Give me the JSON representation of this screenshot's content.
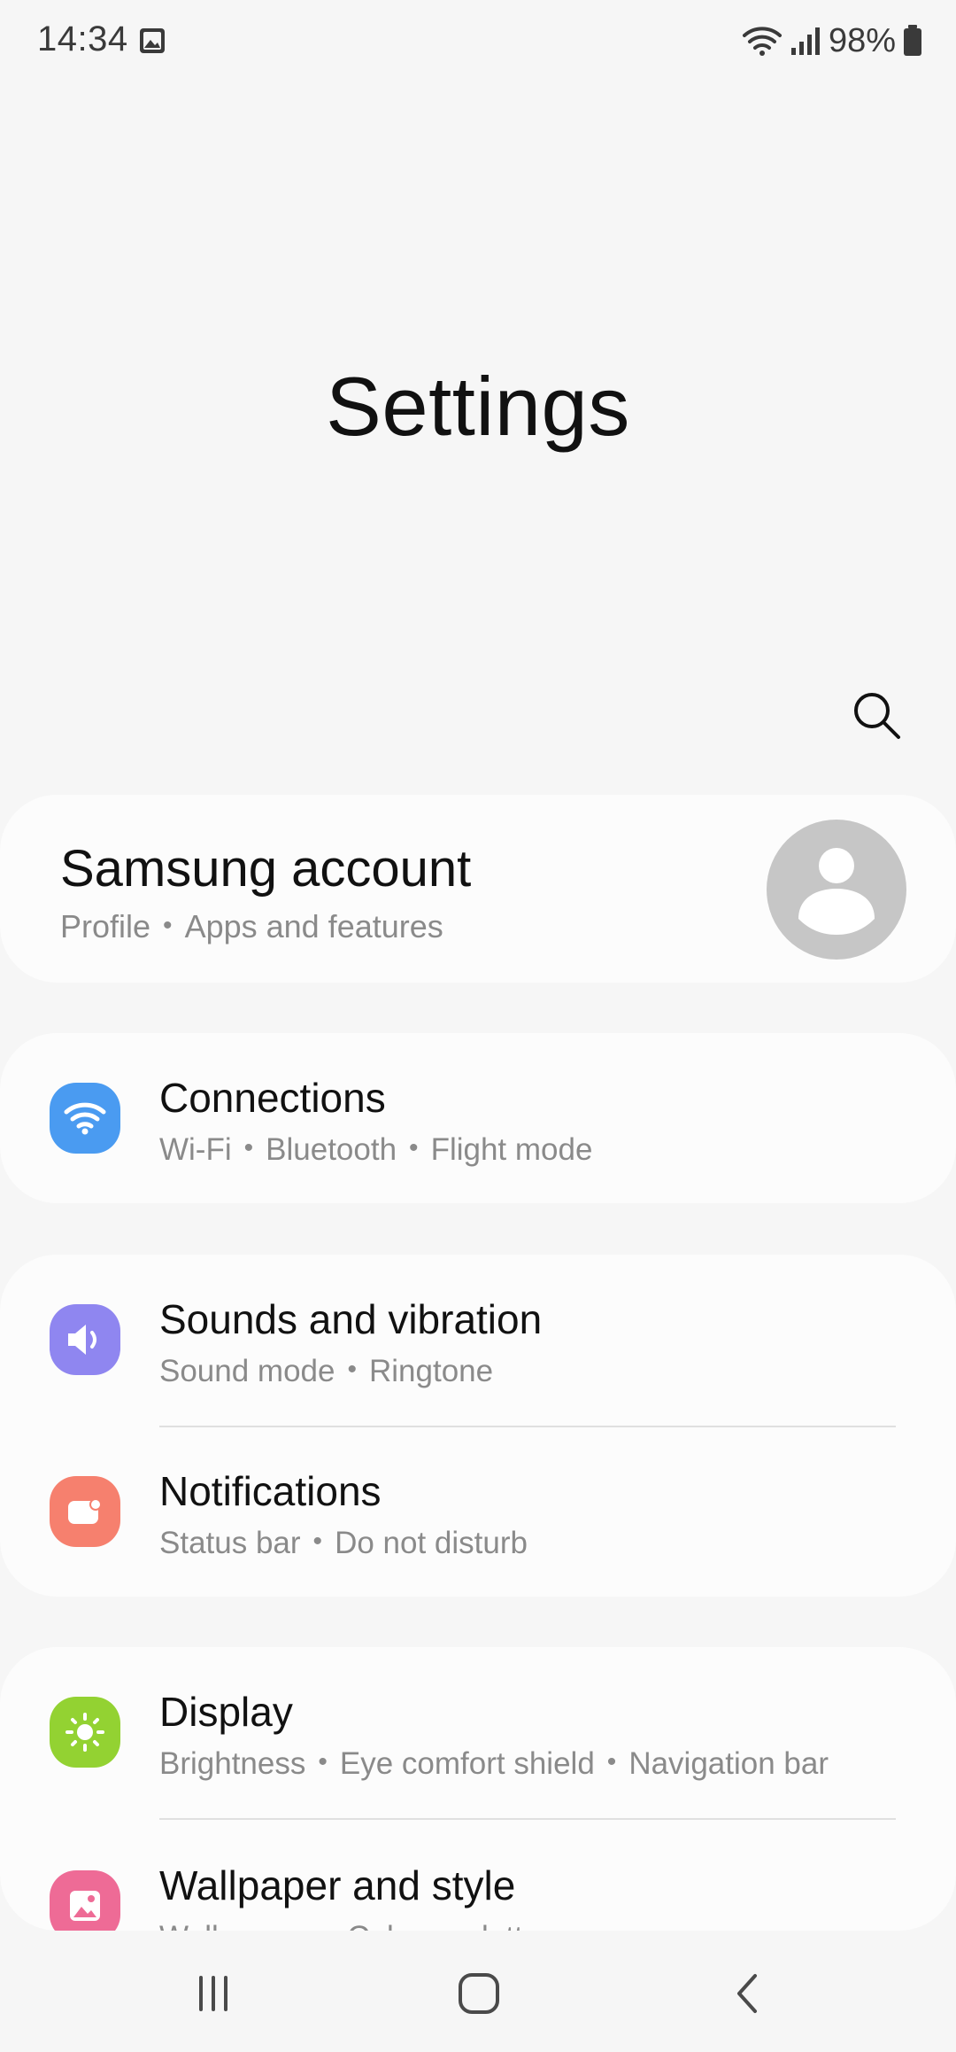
{
  "status": {
    "time": "14:34",
    "battery": "98%"
  },
  "title": "Settings",
  "account": {
    "title": "Samsung account",
    "sub1": "Profile",
    "sub2": "Apps and features"
  },
  "rows": [
    {
      "title": "Connections",
      "subs": [
        "Wi-Fi",
        "Bluetooth",
        "Flight mode"
      ],
      "color": "#4a9bf1"
    },
    {
      "title": "Sounds and vibration",
      "subs": [
        "Sound mode",
        "Ringtone"
      ],
      "color": "#8f86f0"
    },
    {
      "title": "Notifications",
      "subs": [
        "Status bar",
        "Do not disturb"
      ],
      "color": "#f6806e"
    },
    {
      "title": "Display",
      "subs": [
        "Brightness",
        "Eye comfort shield",
        "Navigation bar"
      ],
      "color": "#93d232"
    },
    {
      "title": "Wallpaper and style",
      "subs": [
        "Wallpapers",
        "Colour palette"
      ],
      "color": "#ee6b96"
    }
  ],
  "icons": {
    "status": [
      "gallery-icon",
      "wifi-icon",
      "signal-icon",
      "battery-icon"
    ],
    "search": "search-icon",
    "avatar": "avatar-icon",
    "rows": [
      "wifi-icon",
      "speaker-icon",
      "notification-icon",
      "brightness-icon",
      "wallpaper-icon"
    ],
    "nav": [
      "recents-icon",
      "home-icon",
      "back-icon"
    ]
  }
}
